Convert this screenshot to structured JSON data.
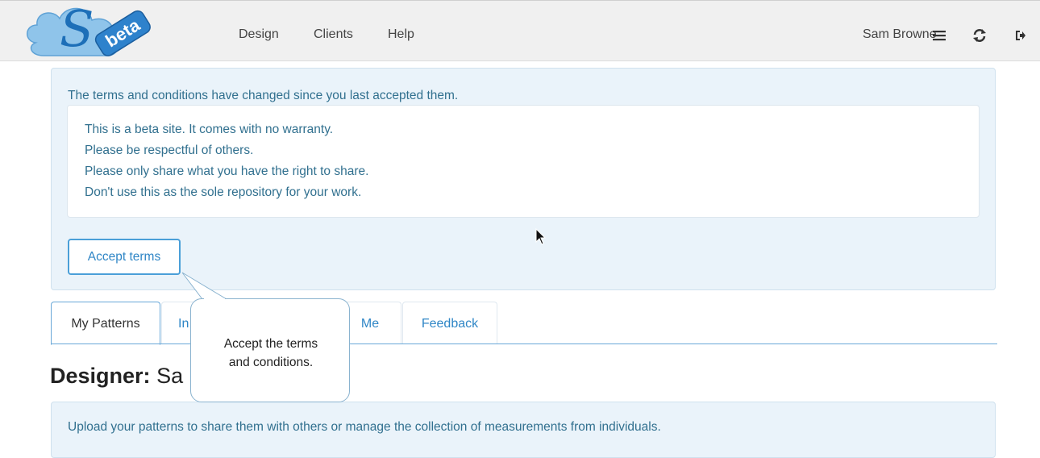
{
  "logo": {
    "text": "beta",
    "icon": "cloud-s-logo"
  },
  "nav": {
    "items": [
      "Design",
      "Clients",
      "Help"
    ],
    "user_name": "Sam Browne",
    "user_menu_icon": "hamburger-icon",
    "refresh_icon": "refresh-icon",
    "logout_icon": "logout-icon"
  },
  "terms": {
    "heading": "The terms and conditions have changed since you last accepted them.",
    "lines": [
      "This is a beta site. It comes with no warranty.",
      "Please be respectful of others.",
      "Please only share what you have the right to share.",
      "Don't use this as the sole repository for your work."
    ],
    "accept_label": "Accept terms"
  },
  "tabs": [
    {
      "label": "My Patterns",
      "active": true
    },
    {
      "label": "In"
    },
    {
      "label": "Me"
    },
    {
      "label": "Feedback"
    }
  ],
  "designer": {
    "prefix": "Designer:",
    "name": "Sa"
  },
  "info": {
    "text": "Upload your patterns to share them with others or manage the collection of measurements from individuals."
  },
  "tooltip": {
    "line1": "Accept the terms",
    "line2": "and conditions."
  },
  "colors": {
    "accent": "#2f86c6",
    "panel_bg": "#eaf3fa",
    "panel_text": "#31708f"
  }
}
